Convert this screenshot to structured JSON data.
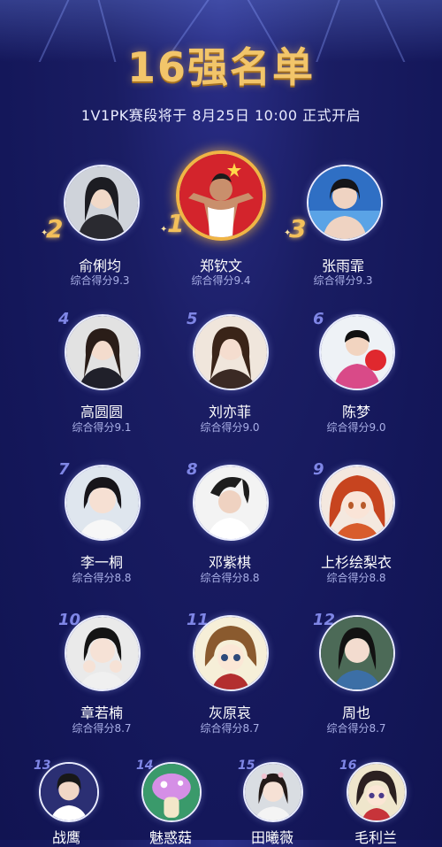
{
  "header": {
    "title": "16强名单",
    "subtitle": "1V1PK赛段将于 8月25日 10:00 正式开启"
  },
  "colors": {
    "accent_gold": "#f2c56a",
    "rank_blue": "#7f86e6",
    "bg": "#14175a"
  },
  "score_label": "综合得分",
  "players": [
    {
      "rank": "2",
      "name": "俞俐均",
      "score": "综合得分9.3",
      "icon": "portrait-photo"
    },
    {
      "rank": "1",
      "name": "郑钦文",
      "score": "综合得分9.4",
      "icon": "portrait-photo"
    },
    {
      "rank": "3",
      "name": "张雨霏",
      "score": "综合得分9.3",
      "icon": "portrait-photo"
    },
    {
      "rank": "4",
      "name": "高圆圆",
      "score": "综合得分9.1",
      "icon": "portrait-photo"
    },
    {
      "rank": "5",
      "name": "刘亦菲",
      "score": "综合得分9.0",
      "icon": "portrait-photo"
    },
    {
      "rank": "6",
      "name": "陈梦",
      "score": "综合得分9.0",
      "icon": "portrait-photo"
    },
    {
      "rank": "7",
      "name": "李一桐",
      "score": "综合得分8.8",
      "icon": "portrait-photo"
    },
    {
      "rank": "8",
      "name": "邓紫棋",
      "score": "综合得分8.8",
      "icon": "portrait-photo"
    },
    {
      "rank": "9",
      "name": "上杉绘梨衣",
      "score": "综合得分8.8",
      "icon": "anime-portrait"
    },
    {
      "rank": "10",
      "name": "章若楠",
      "score": "综合得分8.7",
      "icon": "portrait-photo"
    },
    {
      "rank": "11",
      "name": "灰原哀",
      "score": "综合得分8.7",
      "icon": "anime-portrait"
    },
    {
      "rank": "12",
      "name": "周也",
      "score": "综合得分8.7",
      "icon": "portrait-photo"
    },
    {
      "rank": "13",
      "name": "战鹰",
      "icon": "portrait-photo"
    },
    {
      "rank": "14",
      "name": "魅惑菇",
      "icon": "plant-character-portrait"
    },
    {
      "rank": "15",
      "name": "田曦薇",
      "icon": "portrait-photo"
    },
    {
      "rank": "16",
      "name": "毛利兰",
      "icon": "anime-portrait"
    }
  ]
}
